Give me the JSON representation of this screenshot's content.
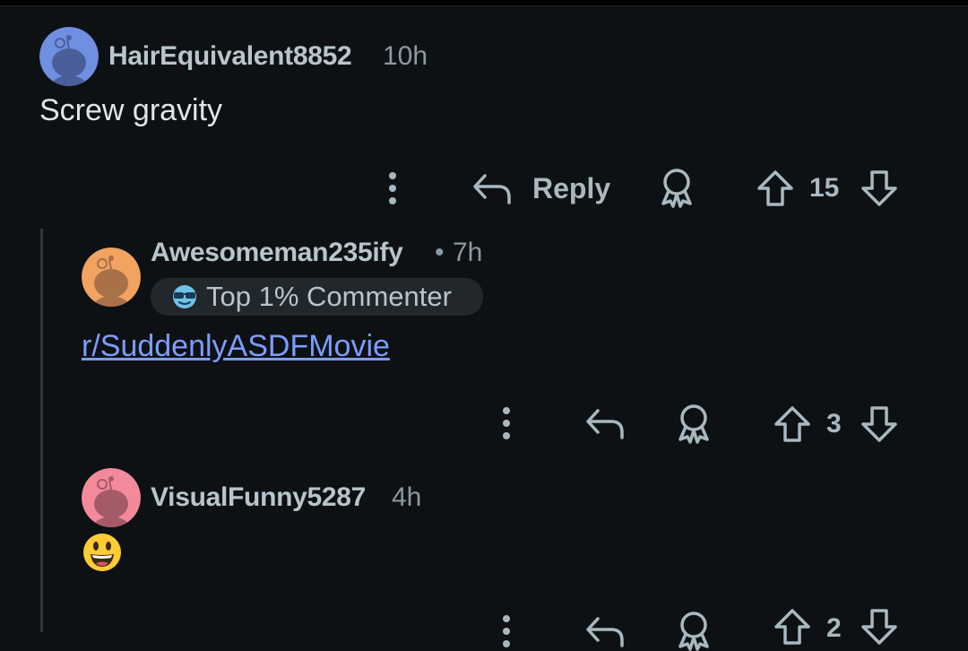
{
  "comments": [
    {
      "username": "HairEquivalent8852",
      "time": "10h",
      "body": "Screw gravity",
      "reply_label": "Reply",
      "score": "15",
      "avatar_color": "#6f8fe0"
    },
    {
      "username": "Awesomeman235ify",
      "separator": "•",
      "time": "7h",
      "badge": {
        "label": "Top 1% Commenter",
        "icon": "sunglasses-icon"
      },
      "body_link": "r/SuddenlyASDFMovie",
      "score": "3",
      "avatar_color": "#f2a360"
    },
    {
      "username": "VisualFunny5287",
      "time": "4h",
      "body_emoji": "grinning-face-emoji",
      "score": "2",
      "avatar_color": "#f28a9c"
    }
  ],
  "colors": {
    "background": "#0e1113",
    "link": "#7b9dff",
    "text": "#b7c5cc",
    "muted": "#8a9aa3"
  }
}
